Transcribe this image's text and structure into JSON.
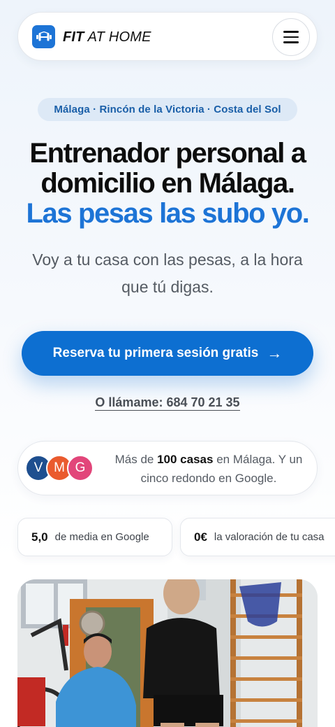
{
  "header": {
    "brand_bold": "FIT",
    "brand_light": "AT HOME",
    "logo_icon": "dumbbell-icon",
    "menu_icon": "hamburger-menu-icon"
  },
  "hero": {
    "location": "Málaga · Rincón de la Victoria · Costa del Sol",
    "title_line1": "Entrenador personal a",
    "title_line2": "domicilio en Málaga.",
    "title_accent": "Las pesas las subo yo.",
    "subtitle": "Voy a tu casa con las pesas, a la hora que tú digas.",
    "cta_label": "Reserva tu primera sesión gratis",
    "cta_arrow": "→",
    "call_label": "O llámame: 684 70 21 35"
  },
  "social_proof": {
    "avatars": [
      "V",
      "M",
      "G"
    ],
    "text_before": "Más de ",
    "text_bold": "100 casas",
    "text_after": " en Málaga. Y un cinco redondo en Google."
  },
  "stats": [
    {
      "value": "5,0",
      "label": "de media en Google"
    },
    {
      "value": "0€",
      "label": "la valoración de tu casa"
    }
  ],
  "colors": {
    "accent": "#1d74d6",
    "cta": "#0d6fd1",
    "pill_bg": "#dde9f6"
  }
}
